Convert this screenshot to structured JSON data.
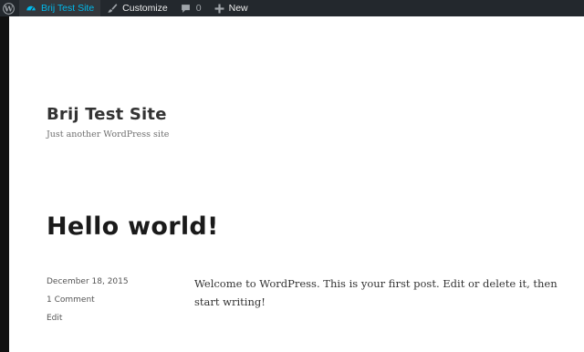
{
  "admin_bar": {
    "site_name": "Brij Test Site",
    "customize_label": "Customize",
    "comments_count": "0",
    "new_label": "New"
  },
  "site": {
    "title": "Brij Test Site",
    "description": "Just another WordPress site"
  },
  "post": {
    "title": "Hello world!",
    "date": "December 18, 2015",
    "comments_link": "1 Comment",
    "edit_link": "Edit",
    "content": "Welcome to WordPress. This is your first post. Edit or delete it, then start writing!"
  },
  "colors": {
    "admin_bar_bg": "#23282d",
    "admin_bar_active_bg": "#32373c",
    "admin_bar_active_text": "#00b9eb",
    "page_bg": "#ffffff",
    "frame_bg": "#111111"
  },
  "icons": [
    "wordpress-logo-icon",
    "dashboard-gauge-icon",
    "paintbrush-icon",
    "comment-bubble-icon",
    "plus-icon"
  ]
}
